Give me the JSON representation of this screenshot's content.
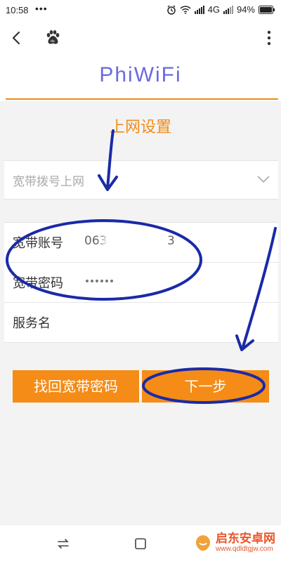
{
  "status_bar": {
    "time": "10:58",
    "dots": "•••",
    "network": "4G",
    "battery": "94%"
  },
  "toolbar": {
    "back_icon": "back-arrow-icon",
    "browser_icon": "baidu-paw-icon",
    "more_icon": "more-vertical-icon"
  },
  "brand": {
    "logo_text": "PhiWiFi",
    "accent_color": "#f28a18",
    "logo_color": "#6a6ae0"
  },
  "page": {
    "title": "上网设置"
  },
  "connection_select": {
    "selected": "宽带拨号上网"
  },
  "form": {
    "account_label": "宽带账号",
    "account_value_start": "063",
    "account_value_end": "3",
    "password_label": "宽带密码",
    "password_mask_count": 6,
    "service_label": "服务名"
  },
  "buttons": {
    "recover_password": "找回宽带密码",
    "next": "下一步",
    "button_color": "#f48c17"
  },
  "annotation": {
    "color": "#1a2aa8"
  },
  "nav_bar": {
    "icons": [
      "switch-icon",
      "home-square-icon"
    ]
  },
  "watermark": {
    "main": "启东安卓网",
    "sub": "www.qdldtgjw.com"
  }
}
